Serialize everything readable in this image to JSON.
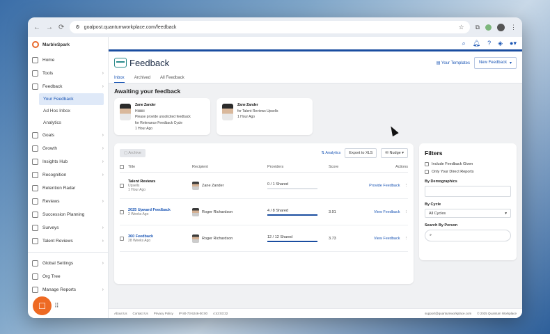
{
  "browser": {
    "url": "goalpost.quantumworkplace.com/feedback"
  },
  "sidebar": {
    "brand": "MarbleSpark",
    "items": [
      {
        "label": "Home",
        "chevron": false
      },
      {
        "label": "Tools",
        "chevron": true
      },
      {
        "label": "Feedback",
        "chevron": true
      }
    ],
    "sub_items": [
      "Your Feedback",
      "Ad Hoc Inbox",
      "Analytics"
    ],
    "items2": [
      {
        "label": "Goals",
        "chevron": true
      },
      {
        "label": "Growth",
        "chevron": true
      },
      {
        "label": "Insights Hub",
        "chevron": true
      },
      {
        "label": "Recognition",
        "chevron": true
      },
      {
        "label": "Retention Radar",
        "chevron": false
      },
      {
        "label": "Reviews",
        "chevron": true
      },
      {
        "label": "Succession Planning",
        "chevron": false
      },
      {
        "label": "Surveys",
        "chevron": true
      },
      {
        "label": "Talent Reviews",
        "chevron": true
      }
    ],
    "items3": [
      {
        "label": "Global Settings",
        "chevron": true
      },
      {
        "label": "Org Tree",
        "chevron": false
      },
      {
        "label": "Manage Reports",
        "chevron": true
      }
    ]
  },
  "header": {
    "title": "Feedback",
    "templates_label": "Your Templates",
    "new_feedback_label": "New Feedback"
  },
  "tabs": [
    "Inbox",
    "Archived",
    "All Feedback"
  ],
  "awaiting": {
    "title": "Awaiting your feedback",
    "cards": [
      {
        "name": "Zane Zander",
        "line1": "Hiiiiiiiii",
        "line2": "Please provide unsolicited feedback",
        "line3": "for Relevance Feedback Cycle",
        "time": "1 Hour Ago"
      },
      {
        "name": "Zane Zander",
        "line1": "for Talent Reviews Upsells",
        "line2": "1 Hour Ago",
        "line3": "",
        "time": ""
      }
    ]
  },
  "table": {
    "archive_label": "Archive",
    "analytics_label": "Analytics",
    "export_label": "Export to XLS",
    "nudge_label": "Nudge",
    "columns": [
      "Title",
      "Recipient",
      "Providers",
      "Score",
      "Actions"
    ],
    "rows": [
      {
        "title": "Talent Reviews",
        "sub1": "Upsells",
        "sub2": "1 Hour Ago",
        "recipient": "Zane Zander",
        "providers": "0 / 1 Shared",
        "progress": 0,
        "score": "",
        "action": "Provide Feedback",
        "link": false
      },
      {
        "title": "2025 Upward Feedback",
        "sub1": "2 Weeks Ago",
        "sub2": "",
        "recipient": "Roger Richardson",
        "providers": "4 / 8 Shared",
        "progress": 1.0,
        "score": "3.91",
        "action": "View Feedback",
        "link": true
      },
      {
        "title": "360 Feedback",
        "sub1": "28 Weeks Ago",
        "sub2": "",
        "recipient": "Roger Richardson",
        "providers": "12 / 12 Shared",
        "progress": 1.0,
        "score": "3.73",
        "action": "View Feedback",
        "link": true
      }
    ]
  },
  "filters": {
    "title": "Filters",
    "check1": "Include Feedback Given",
    "check2": "Only Your Direct Reports",
    "demographics_label": "By Demographics",
    "cycle_label": "By Cycle",
    "cycle_value": "All Cycles",
    "person_label": "Search By Person"
  },
  "footer": {
    "links": [
      "About Us",
      "Contact Us",
      "Privacy Policy",
      "IP 80-73-5246-00:00",
      "4:43:03:32"
    ],
    "email": "support@quantumworkplace.com",
    "copyright": "© 2025 Quantum Workplace"
  }
}
